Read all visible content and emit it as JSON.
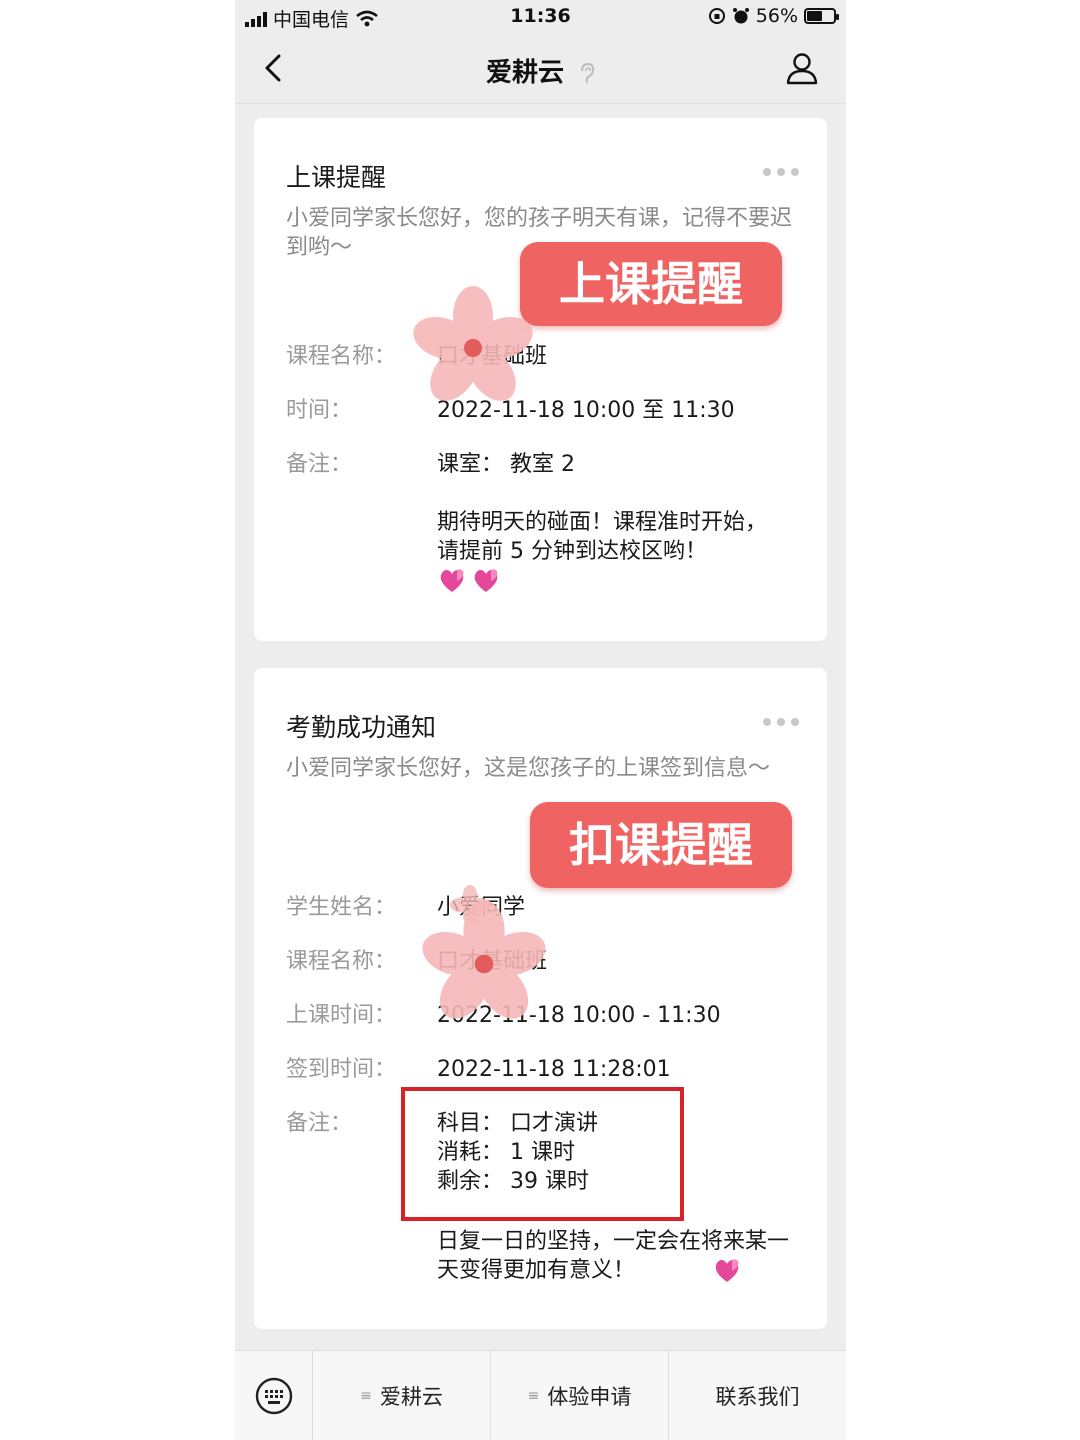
{
  "status_bar": {
    "carrier": "中国电信",
    "time": "11:36",
    "battery": "56%",
    "battery_level": 0.56
  },
  "nav": {
    "title": "爱耕云",
    "back_icon": "chevron-left-icon",
    "user_icon": "user-icon"
  },
  "card1": {
    "title": "上课提醒",
    "intro": "小爱同学家长您好，您的孩子明天有课，记得不要迟到哟～",
    "stamp": "上课提醒",
    "course_label": "课程名称：",
    "course_value": "口才基础班",
    "time_label": "时间：",
    "time_value": "2022-11-18 10:00 至 11:30",
    "remark_label": "备注：",
    "remark_room": "课室： 教室 2",
    "remark_msg": "期待明天的碰面！课程准时开始，请提前 5 分钟到达校区哟！"
  },
  "card2": {
    "title": "考勤成功通知",
    "intro": "小爱同学家长您好，这是您孩子的上课签到信息～",
    "stamp": "扣课提醒",
    "student_label": "学生姓名：",
    "student_value": "小爱同学",
    "course_label": "课程名称：",
    "course_value": "口才基础班",
    "class_time_label": "上课时间：",
    "class_time_value": "2022-11-18 10:00 - 11:30",
    "checkin_label": "签到时间：",
    "checkin_value": "2022-11-18 11:28:01",
    "remark_label": "备注：",
    "subject": "科目： 口才演讲",
    "consumed": "消耗： 1 课时",
    "remaining": "剩余： 39 课时",
    "remark_msg": "日复一日的坚持，一定会在将来某一天变得更加有意义！"
  },
  "menu": {
    "items": [
      "爱耕云",
      "体验申请",
      "联系我们"
    ]
  },
  "colors": {
    "stamp": "#f06363",
    "highlight_box": "#d8222a",
    "page_bg": "#ededed"
  }
}
